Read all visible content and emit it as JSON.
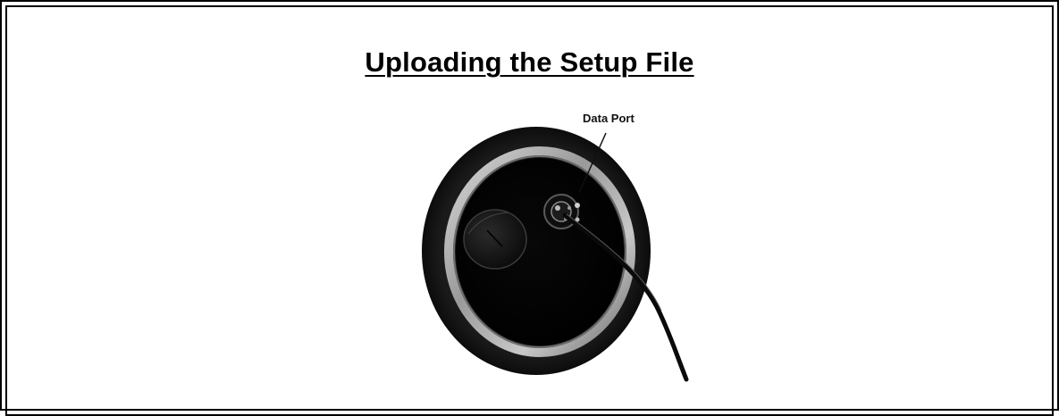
{
  "page": {
    "title": "Uploading the Setup File"
  },
  "figure": {
    "callout_label": "Data Port",
    "description_icon": "camera-lens-port-photo"
  }
}
